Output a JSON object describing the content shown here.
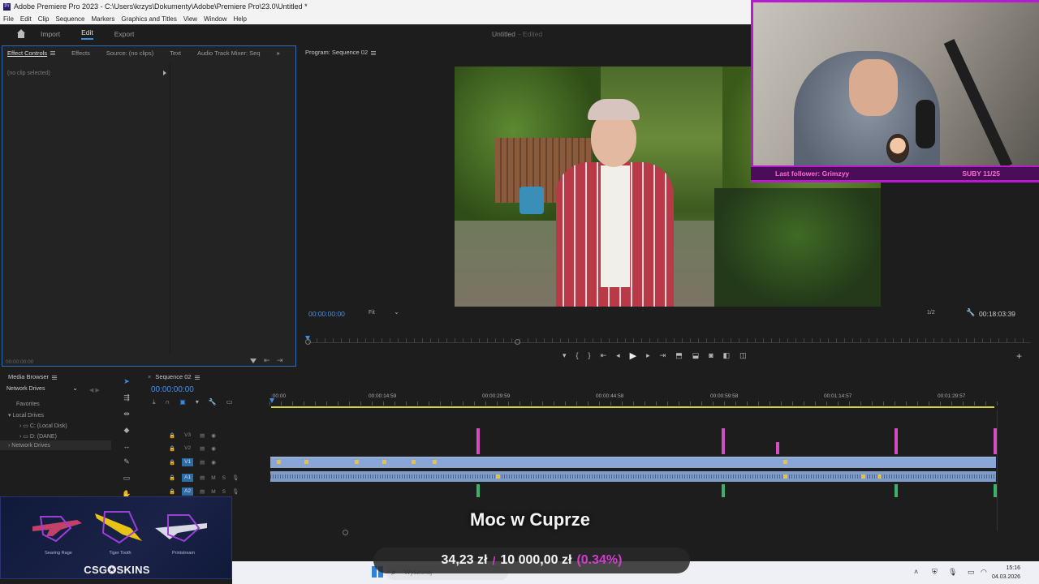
{
  "titlebar": {
    "title": "Adobe Premiere Pro 2023 - C:\\Users\\krzys\\Dokumenty\\Adobe\\Premiere Pro\\23.0\\Untitled *"
  },
  "menubar": [
    "File",
    "Edit",
    "Clip",
    "Sequence",
    "Markers",
    "Graphics and Titles",
    "View",
    "Window",
    "Help"
  ],
  "workspace": {
    "tabs": [
      "Import",
      "Edit",
      "Export"
    ],
    "active": "Edit",
    "doc_title": "Untitled",
    "doc_status": "- Edited"
  },
  "effect_controls": {
    "tabs": [
      "Effect Controls",
      "Effects",
      "Source: (no clips)",
      "Text",
      "Audio Track Mixer: Seq"
    ],
    "no_clip": "(no clip selected)",
    "timecode": "00:00:00:00"
  },
  "program": {
    "title": "Program: Sequence 02",
    "timecode": "00:00:00:00",
    "zoom": "Fit",
    "resolution": "1/2",
    "duration": "00:18:03:39"
  },
  "webcam": {
    "last_follower": "Last follower: Grimzyy",
    "sub": "SUBY 11/25"
  },
  "media_browser": {
    "title": "Media Browser",
    "location": "Network Drives",
    "tree": [
      "Favorites",
      "Local Drives",
      "C: (Local Disk)",
      "D: (DANE)",
      "Network Drives"
    ]
  },
  "timeline": {
    "tab": "Sequence 02",
    "timecode": "00:00:00:00",
    "ruler": [
      ":00:00",
      "00:00:14:59",
      "00:00:29:59",
      "00:00:44:58",
      "00:00:59:58",
      "00:01:14:57",
      "00:01:29:57"
    ],
    "tracks": [
      "V3",
      "V2",
      "V1",
      "A1",
      "A2"
    ]
  },
  "csg": {
    "skins": [
      "Searing Rage",
      "Tiger Tooth",
      "Printstream"
    ],
    "logo": "CSG✪SKINS"
  },
  "donation": {
    "title": "Moc w Cuprze",
    "current": "34,23 zł",
    "goal": "10 000,00 zł",
    "percent": "(0.34%)"
  },
  "taskbar": {
    "search_placeholder": "Wyszukaj",
    "time": "15:16",
    "date": "04.03.2026"
  },
  "colors": {
    "accent": "#3a8ee6",
    "timecode": "#4c8fe0",
    "overlay_purple": "#b41ccc"
  }
}
